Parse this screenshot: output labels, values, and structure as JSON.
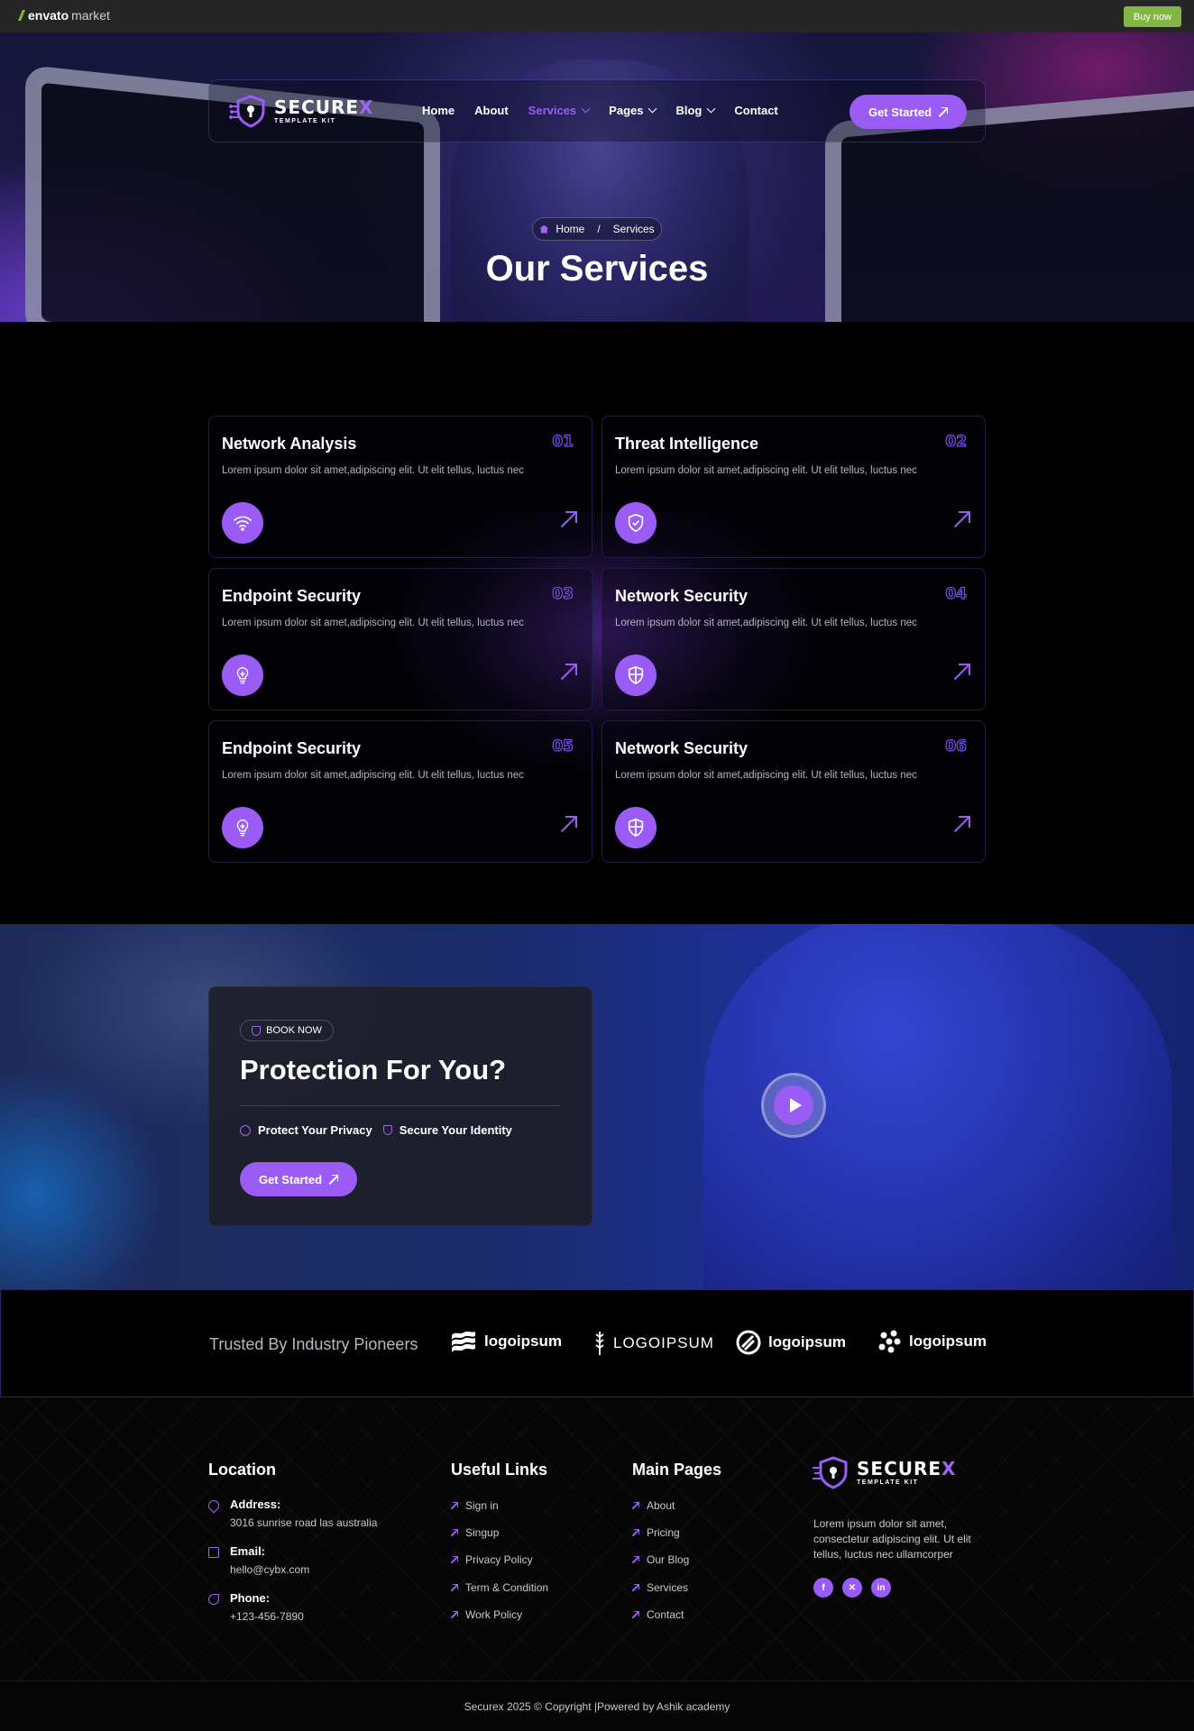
{
  "envato": {
    "brand": "envato",
    "brand_suffix": "market",
    "buy_now": "Buy now"
  },
  "brand": {
    "name_main": "SECURE",
    "name_accent": "X",
    "tagline": "TEMPLATE KIT"
  },
  "nav": {
    "items": [
      {
        "label": "Home",
        "active": false,
        "dropdown": false
      },
      {
        "label": "About",
        "active": false,
        "dropdown": false
      },
      {
        "label": "Services",
        "active": true,
        "dropdown": true
      },
      {
        "label": "Pages",
        "active": false,
        "dropdown": true
      },
      {
        "label": "Blog",
        "active": false,
        "dropdown": true
      },
      {
        "label": "Contact",
        "active": false,
        "dropdown": false
      }
    ],
    "cta": "Get Started"
  },
  "hero": {
    "breadcrumb": [
      "Home",
      "/",
      "Services"
    ],
    "title": "Our Services"
  },
  "services": [
    {
      "title": "Network Analysis",
      "number": "01",
      "desc": "Lorem ipsum dolor sit amet,adipiscing elit. Ut elit tellus, luctus nec",
      "icon": "wifi-icon"
    },
    {
      "title": "Threat Intelligence",
      "number": "02",
      "desc": "Lorem ipsum dolor sit amet,adipiscing elit. Ut elit tellus, luctus nec",
      "icon": "shield-check-icon"
    },
    {
      "title": "Endpoint Security",
      "number": "03",
      "desc": "Lorem ipsum dolor sit amet,adipiscing elit. Ut elit tellus, luctus nec",
      "icon": "lightbulb-icon"
    },
    {
      "title": "Network Security",
      "number": "04",
      "desc": "Lorem ipsum dolor sit amet,adipiscing elit. Ut elit tellus, luctus nec",
      "icon": "shield-icon"
    },
    {
      "title": "Endpoint Security",
      "number": "05",
      "desc": "Lorem ipsum dolor sit amet,adipiscing elit. Ut elit tellus, luctus nec",
      "icon": "lightbulb-icon"
    },
    {
      "title": "Network Security",
      "number": "06",
      "desc": "Lorem ipsum dolor sit amet,adipiscing elit. Ut elit tellus, luctus nec",
      "icon": "shield-icon"
    }
  ],
  "booking": {
    "tag": "BOOK NOW",
    "title": "Protection For You?",
    "features": [
      "Protect Your Privacy",
      "Secure Your Identity"
    ],
    "cta": "Get Started"
  },
  "trusted": {
    "label": "Trusted By Industry Pioneers",
    "logos": [
      "logoipsum",
      "LOGOIPSUM",
      "logoipsum",
      "logoipsum"
    ]
  },
  "footer": {
    "location": {
      "heading": "Location",
      "address_label": "Address:",
      "address": "3016 sunrise road las australia",
      "email_label": "Email:",
      "email": "hello@cybx.com",
      "phone_label": "Phone:",
      "phone": "+123-456-7890"
    },
    "useful_links": {
      "heading": "Useful Links",
      "items": [
        "Sign in",
        "Singup",
        "Privacy Policy",
        "Term & Condition",
        "Work Policy"
      ]
    },
    "main_pages": {
      "heading": "Main Pages",
      "items": [
        "About",
        "Pricing",
        "Our Blog",
        "Services",
        "Contact"
      ]
    },
    "about": "Lorem ipsum dolor sit amet, consectetur adipiscing elit. Ut elit tellus, luctus nec ullamcorper",
    "social": [
      "facebook-icon",
      "x-icon",
      "linkedin-icon"
    ],
    "copyright": "Securex 2025 © Copyright |Powered by Ashik academy"
  },
  "colors": {
    "accent": "#9b5cf5",
    "envato_green": "#82b541",
    "background": "#000000"
  }
}
